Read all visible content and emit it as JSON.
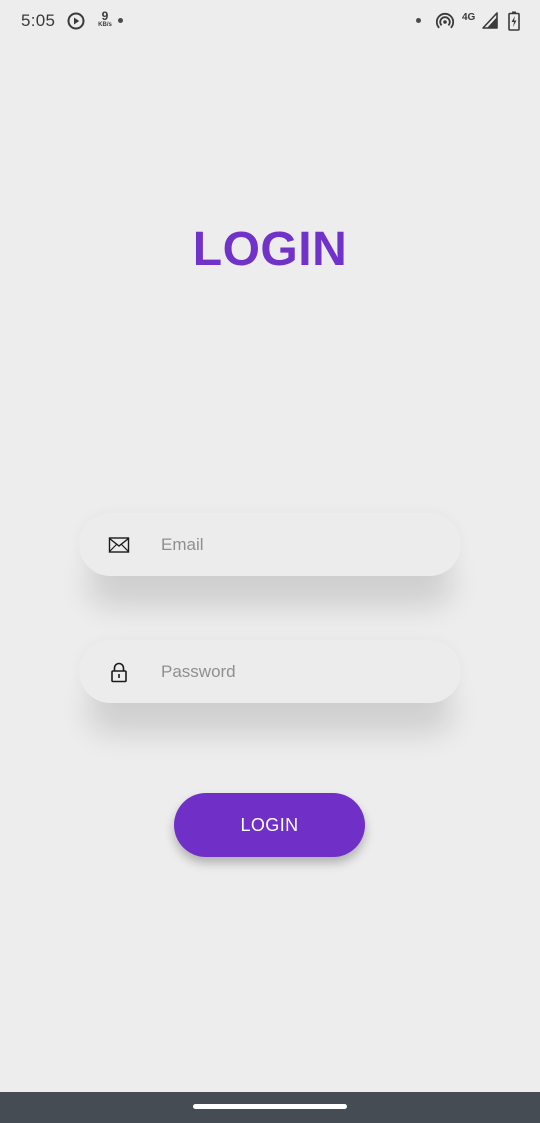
{
  "status_bar": {
    "time": "5:05",
    "net_speed_value": "9",
    "net_speed_unit": "KB/s",
    "network_type": "4G",
    "icons": [
      "play-circle-icon",
      "dot-icon",
      "dot-icon",
      "hotspot-icon",
      "signal-icon",
      "battery-charging-icon"
    ]
  },
  "title": "LOGIN",
  "form": {
    "email": {
      "icon": "mail-icon",
      "placeholder": "Email",
      "value": ""
    },
    "password": {
      "icon": "lock-icon",
      "placeholder": "Password",
      "value": ""
    },
    "submit_label": "LOGIN"
  },
  "colors": {
    "accent": "#7032c9",
    "background": "#ededed",
    "nav_bar": "#454c54"
  }
}
